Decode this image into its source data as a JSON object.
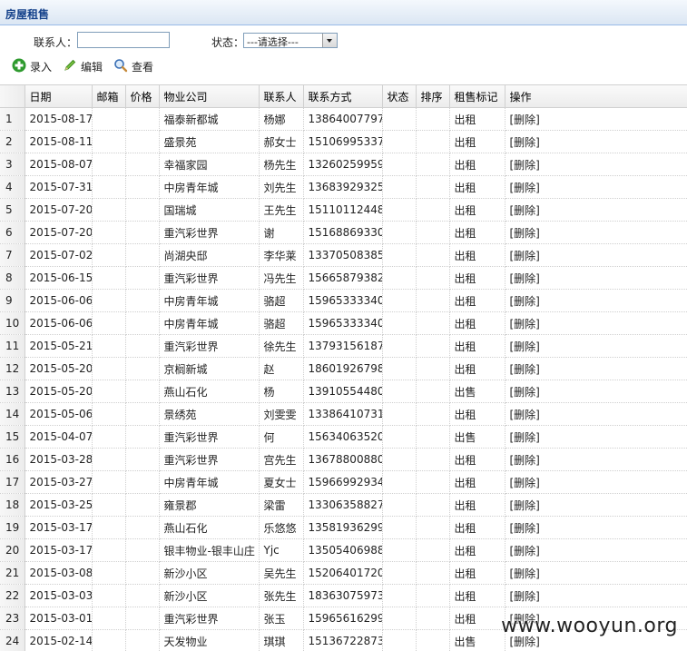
{
  "panel": {
    "title": "房屋租售"
  },
  "search": {
    "contact_label": "联系人：",
    "contact_value": "",
    "status_label": "状态：",
    "status_selected": "---请选择---"
  },
  "toolbar": {
    "add_label": "录入",
    "edit_label": "编辑",
    "view_label": "查看"
  },
  "columns": [
    "",
    "日期",
    "邮箱",
    "价格",
    "物业公司",
    "联系人",
    "联系方式",
    "状态",
    "排序",
    "租售标记",
    "操作"
  ],
  "delete_label": "[删除]",
  "rows": [
    {
      "n": "1",
      "date": "2015-08-17",
      "email": "",
      "price": "",
      "company": "福泰新都城",
      "contact": "杨娜",
      "phone": "13864007797",
      "status": "",
      "sort": "",
      "mark": "出租"
    },
    {
      "n": "2",
      "date": "2015-08-11",
      "email": "",
      "price": "",
      "company": "盛景苑",
      "contact": "郝女士",
      "phone": "15106995337",
      "status": "",
      "sort": "",
      "mark": "出租"
    },
    {
      "n": "3",
      "date": "2015-08-07",
      "email": "",
      "price": "",
      "company": "幸福家园",
      "contact": "杨先生",
      "phone": "13260259959",
      "status": "",
      "sort": "",
      "mark": "出租"
    },
    {
      "n": "4",
      "date": "2015-07-31",
      "email": "",
      "price": "",
      "company": "中房青年城",
      "contact": "刘先生",
      "phone": "13683929325",
      "status": "",
      "sort": "",
      "mark": "出租"
    },
    {
      "n": "5",
      "date": "2015-07-20",
      "email": "",
      "price": "",
      "company": "国瑞城",
      "contact": "王先生",
      "phone": "15110112448",
      "status": "",
      "sort": "",
      "mark": "出租"
    },
    {
      "n": "6",
      "date": "2015-07-20",
      "email": "",
      "price": "",
      "company": "重汽彩世界",
      "contact": "谢",
      "phone": "15168869330",
      "status": "",
      "sort": "",
      "mark": "出租"
    },
    {
      "n": "7",
      "date": "2015-07-02",
      "email": "",
      "price": "",
      "company": "尚湖央邸",
      "contact": "李华莱",
      "phone": "13370508385",
      "status": "",
      "sort": "",
      "mark": "出租"
    },
    {
      "n": "8",
      "date": "2015-06-15",
      "email": "",
      "price": "",
      "company": "重汽彩世界",
      "contact": "冯先生",
      "phone": "15665879382",
      "status": "",
      "sort": "",
      "mark": "出租"
    },
    {
      "n": "9",
      "date": "2015-06-06",
      "email": "",
      "price": "",
      "company": "中房青年城",
      "contact": "骆超",
      "phone": "15965333340",
      "status": "",
      "sort": "",
      "mark": "出租"
    },
    {
      "n": "10",
      "date": "2015-06-06",
      "email": "",
      "price": "",
      "company": "中房青年城",
      "contact": "骆超",
      "phone": "15965333340",
      "status": "",
      "sort": "",
      "mark": "出租"
    },
    {
      "n": "11",
      "date": "2015-05-21",
      "email": "",
      "price": "",
      "company": "重汽彩世界",
      "contact": "徐先生",
      "phone": "13793156187",
      "status": "",
      "sort": "",
      "mark": "出租"
    },
    {
      "n": "12",
      "date": "2015-05-20",
      "email": "",
      "price": "",
      "company": "京榈新城",
      "contact": "赵",
      "phone": "18601926798",
      "status": "",
      "sort": "",
      "mark": "出租"
    },
    {
      "n": "13",
      "date": "2015-05-20",
      "email": "",
      "price": "",
      "company": "燕山石化",
      "contact": "杨",
      "phone": "13910554480",
      "status": "",
      "sort": "",
      "mark": "出售"
    },
    {
      "n": "14",
      "date": "2015-05-06",
      "email": "",
      "price": "",
      "company": "景绣苑",
      "contact": "刘雯雯",
      "phone": "13386410731",
      "status": "",
      "sort": "",
      "mark": "出租"
    },
    {
      "n": "15",
      "date": "2015-04-07",
      "email": "",
      "price": "",
      "company": "重汽彩世界",
      "contact": "何",
      "phone": "15634063520",
      "status": "",
      "sort": "",
      "mark": "出售"
    },
    {
      "n": "16",
      "date": "2015-03-28",
      "email": "",
      "price": "",
      "company": "重汽彩世界",
      "contact": "宫先生",
      "phone": "13678800880",
      "status": "",
      "sort": "",
      "mark": "出租"
    },
    {
      "n": "17",
      "date": "2015-03-27",
      "email": "",
      "price": "",
      "company": "中房青年城",
      "contact": "夏女士",
      "phone": "15966992934",
      "status": "",
      "sort": "",
      "mark": "出租"
    },
    {
      "n": "18",
      "date": "2015-03-25",
      "email": "",
      "price": "",
      "company": "雍景郡",
      "contact": "梁雷",
      "phone": "13306358827",
      "status": "",
      "sort": "",
      "mark": "出租"
    },
    {
      "n": "19",
      "date": "2015-03-17",
      "email": "",
      "price": "",
      "company": "燕山石化",
      "contact": "乐悠悠",
      "phone": "13581936299",
      "status": "",
      "sort": "",
      "mark": "出租"
    },
    {
      "n": "20",
      "date": "2015-03-17",
      "email": "",
      "price": "",
      "company": "银丰物业-银丰山庄",
      "contact": "Yjc",
      "phone": "13505406988",
      "status": "",
      "sort": "",
      "mark": "出租"
    },
    {
      "n": "21",
      "date": "2015-03-08",
      "email": "",
      "price": "",
      "company": "新沙小区",
      "contact": "吴先生",
      "phone": "15206401720",
      "status": "",
      "sort": "",
      "mark": "出租"
    },
    {
      "n": "22",
      "date": "2015-03-03",
      "email": "",
      "price": "",
      "company": "新沙小区",
      "contact": "张先生",
      "phone": "18363075973",
      "status": "",
      "sort": "",
      "mark": "出租"
    },
    {
      "n": "23",
      "date": "2015-03-01",
      "email": "",
      "price": "",
      "company": "重汽彩世界",
      "contact": "张玉",
      "phone": "15965616299",
      "status": "",
      "sort": "",
      "mark": "出租"
    },
    {
      "n": "24",
      "date": "2015-02-14",
      "email": "",
      "price": "",
      "company": "天发物业",
      "contact": "琪琪",
      "phone": "15136722873",
      "status": "",
      "sort": "",
      "mark": "出售"
    }
  ],
  "watermark": "www.wooyun.org",
  "colors": {
    "header_text": "#15428b",
    "add_icon": "#2e9a2e",
    "edit_icon": "#3c8a1e",
    "view_icon": "#3a6fb5"
  },
  "icons": {
    "add": "plus-circle-icon",
    "edit": "pencil-icon",
    "view": "magnifier-icon"
  }
}
